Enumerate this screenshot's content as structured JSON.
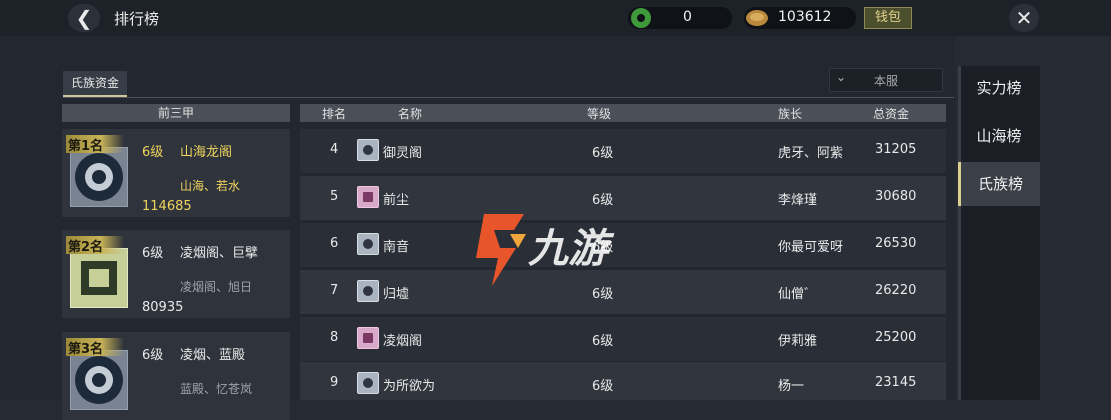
{
  "header": {
    "title": "排行榜",
    "jade_value": "0",
    "coin_value": "103612",
    "wallet_label": "钱包"
  },
  "panel": {
    "tab_label": "氏族资金",
    "server_option": "本服",
    "top3_header": "前三甲"
  },
  "top3": [
    {
      "rank": "第1名",
      "level": "6级",
      "name": "山海龙阁",
      "leaders": "山海、若水",
      "funds": "114685"
    },
    {
      "rank": "第2名",
      "level": "6级",
      "name": "凌烟阁、巨擘",
      "leaders": "凌烟阁、旭日",
      "funds": "80935"
    },
    {
      "rank": "第3名",
      "level": "6级",
      "name": "凌烟、蓝殿",
      "leaders": "蓝殿、忆苍岚",
      "funds": ""
    }
  ],
  "table": {
    "columns": [
      "排名",
      "名称",
      "等级",
      "族长",
      "总资金"
    ],
    "rows": [
      {
        "rank": "4",
        "name": "御灵阁",
        "level": "6级",
        "leader": "虎牙、阿紫",
        "funds": "31205"
      },
      {
        "rank": "5",
        "name": "前尘",
        "level": "6级",
        "leader": "李烽瑾",
        "funds": "30680"
      },
      {
        "rank": "6",
        "name": "南音",
        "level": "6级",
        "leader": "你最可爱呀",
        "funds": "26530"
      },
      {
        "rank": "7",
        "name": "归墟",
        "level": "6级",
        "leader": "仙僧゛",
        "funds": "26220"
      },
      {
        "rank": "8",
        "name": "凌烟阁",
        "level": "6级",
        "leader": "伊莉雅",
        "funds": "25200"
      },
      {
        "rank": "9",
        "name": "为所欲为",
        "level": "6级",
        "leader": "杨一",
        "funds": "23145"
      }
    ]
  },
  "sidebar": {
    "items": [
      "实力榜",
      "山海榜",
      "氏族榜"
    ]
  },
  "watermark": {
    "text": "九游"
  },
  "colors": {
    "gold": "#f0d45e",
    "white": "#e9e9e9",
    "gray": "#9ea3aa",
    "accent": "#d9cf8e"
  }
}
